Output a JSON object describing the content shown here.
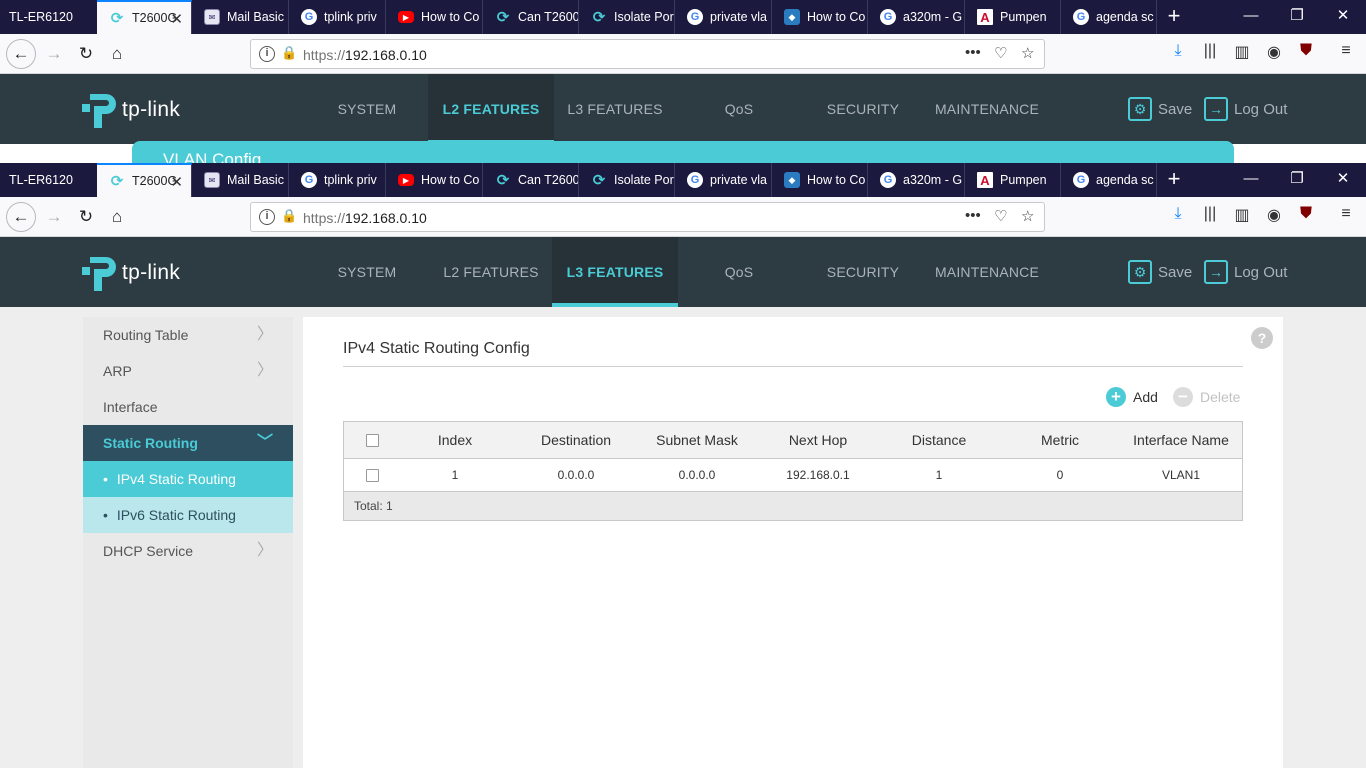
{
  "browser": {
    "tabs": [
      {
        "label": "TL-ER6120",
        "favicon": "none",
        "active": false
      },
      {
        "label": "T2600G",
        "favicon": "tp-link-icon",
        "active": true
      },
      {
        "label": "Mail Basic",
        "favicon": "mail-icon",
        "active": false
      },
      {
        "label": "tplink priv",
        "favicon": "google-icon",
        "active": false
      },
      {
        "label": "How to Co",
        "favicon": "youtube-icon",
        "active": false
      },
      {
        "label": "Can T2600",
        "favicon": "tp-link-icon",
        "active": false
      },
      {
        "label": "Isolate Por",
        "favicon": "tp-link-icon",
        "active": false
      },
      {
        "label": "private vla",
        "favicon": "google-icon",
        "active": false
      },
      {
        "label": "How to Co",
        "favicon": "shield-icon",
        "active": false
      },
      {
        "label": "a320m - G",
        "favicon": "google-icon",
        "active": false
      },
      {
        "label": "Pumpen",
        "favicon": "pdf-icon",
        "active": false
      },
      {
        "label": "agenda sc",
        "favicon": "google-icon",
        "active": false
      }
    ],
    "url_scheme": "https://",
    "url_host": "192.168.0.10"
  },
  "router": {
    "brand": "tp-link",
    "nav_top_window": [
      "SYSTEM",
      "L2 FEATURES",
      "L3 FEATURES",
      "QoS",
      "SECURITY",
      "MAINTENANCE"
    ],
    "nav_top_window_active": "L2 FEATURES",
    "nav": [
      "SYSTEM",
      "L2 FEATURES",
      "L3 FEATURES",
      "QoS",
      "SECURITY",
      "MAINTENANCE"
    ],
    "nav_active": "L3 FEATURES",
    "save_label": "Save",
    "logout_label": "Log Out",
    "top_window_banner": "VLAN Config"
  },
  "sidebar": {
    "items": [
      {
        "label": "Routing Table",
        "has_chevron": true
      },
      {
        "label": "ARP",
        "has_chevron": true
      },
      {
        "label": "Interface",
        "has_chevron": false
      },
      {
        "label": "Static Routing",
        "expanded": true
      },
      {
        "label": "DHCP Service",
        "has_chevron": true
      }
    ],
    "subitems": [
      {
        "label": "IPv4 Static Routing",
        "active": true
      },
      {
        "label": "IPv6 Static Routing",
        "active": false
      }
    ]
  },
  "content": {
    "title": "IPv4 Static Routing Config",
    "add_label": "Add",
    "delete_label": "Delete",
    "columns": [
      "Index",
      "Destination",
      "Subnet Mask",
      "Next Hop",
      "Distance",
      "Metric",
      "Interface Name"
    ],
    "rows": [
      {
        "index": "1",
        "destination": "0.0.0.0",
        "mask": "0.0.0.0",
        "next_hop": "192.168.0.1",
        "distance": "1",
        "metric": "0",
        "interface": "VLAN1",
        "checked": false
      }
    ],
    "total_label": "Total: 1"
  },
  "colors": {
    "accent": "#4acbd6",
    "header_bg": "#2d3b43",
    "sidebar_active_bg": "#2d4f5f",
    "tabbar_bg": "#1b1a3e"
  }
}
